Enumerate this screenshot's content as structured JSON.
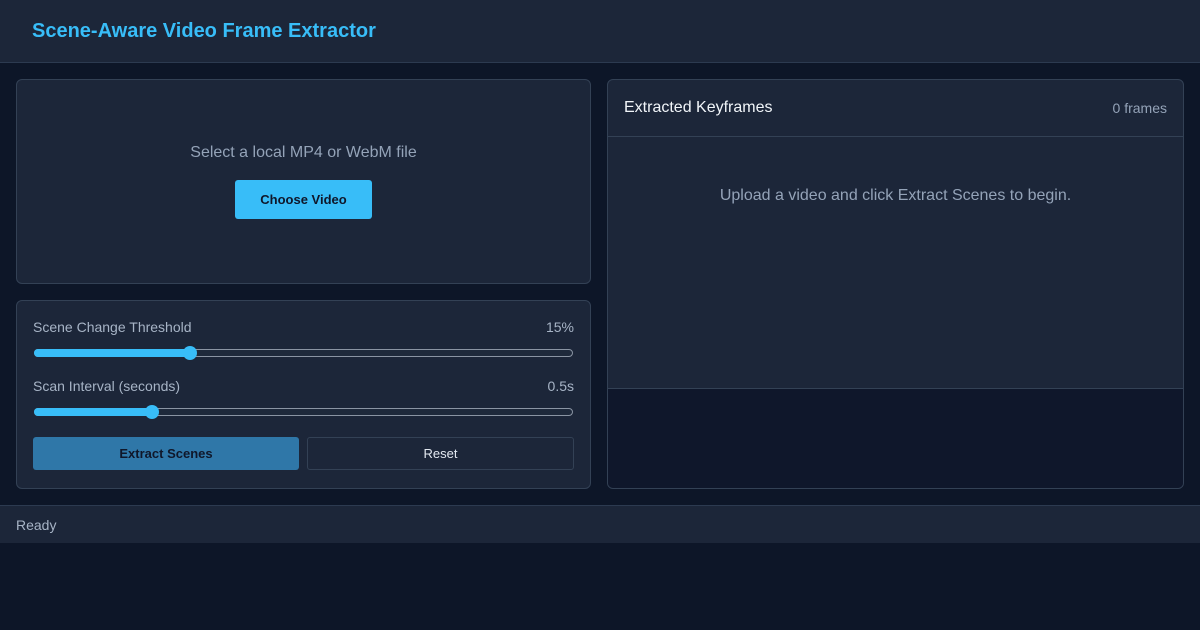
{
  "header": {
    "title": "Scene-Aware Video Frame Extractor"
  },
  "upload": {
    "prompt": "Select a local MP4 or WebM file",
    "choose_label": "Choose Video"
  },
  "controls": {
    "threshold": {
      "label": "Scene Change Threshold",
      "value_text": "15%",
      "fraction": 0.29
    },
    "interval": {
      "label": "Scan Interval (seconds)",
      "value_text": "0.5s",
      "fraction": 0.22
    },
    "extract_label": "Extract Scenes",
    "reset_label": "Reset"
  },
  "frames": {
    "title": "Extracted Keyframes",
    "count": "0 frames",
    "empty_message": "Upload a video and click Extract Scenes to begin."
  },
  "status": {
    "text": "Ready"
  },
  "colors": {
    "accent": "#38bdf8",
    "background": "#0d1628",
    "panel": "#1c2639"
  }
}
